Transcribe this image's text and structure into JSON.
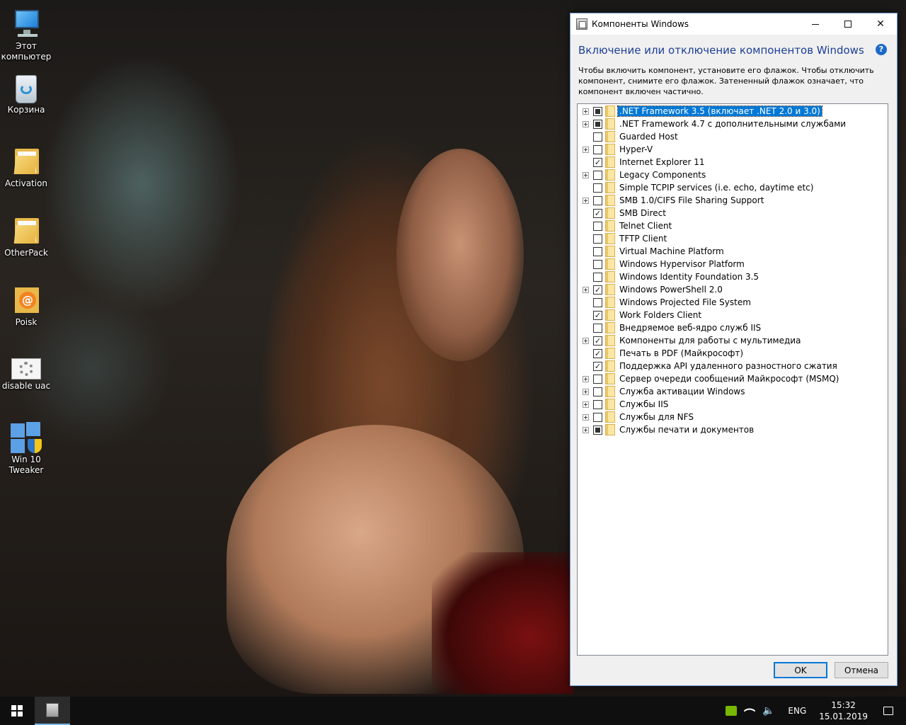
{
  "desktop": {
    "icons": [
      {
        "label": "Этот компьютер",
        "icon": "computer-icon"
      },
      {
        "label": "Корзина",
        "icon": "recycle-bin-icon"
      },
      {
        "label": "Activation",
        "icon": "folder-icon"
      },
      {
        "label": "OtherPack",
        "icon": "folder-icon"
      },
      {
        "label": "Poisk",
        "icon": "poisk-folder-icon"
      },
      {
        "label": "disable uac",
        "icon": "settings-shortcut-icon"
      },
      {
        "label": "Win 10 Tweaker",
        "icon": "tweaker-icon"
      }
    ]
  },
  "window": {
    "title": "Компоненты Windows",
    "heading": "Включение или отключение компонентов Windows",
    "help": "?",
    "description": "Чтобы включить компонент, установите его флажок. Чтобы отключить компонент, снимите его флажок. Затененный флажок означает, что компонент включен частично.",
    "features": [
      {
        "label": ".NET Framework 3.5 (включает .NET 2.0 и 3.0)",
        "expandable": true,
        "state": "partial",
        "selected": true
      },
      {
        "label": ".NET Framework 4.7 с дополнительными службами",
        "expandable": true,
        "state": "partial"
      },
      {
        "label": "Guarded Host",
        "expandable": false,
        "state": "unchecked"
      },
      {
        "label": "Hyper-V",
        "expandable": true,
        "state": "unchecked"
      },
      {
        "label": "Internet Explorer 11",
        "expandable": false,
        "state": "checked"
      },
      {
        "label": "Legacy Components",
        "expandable": true,
        "state": "unchecked"
      },
      {
        "label": "Simple TCPIP services (i.e. echo, daytime etc)",
        "expandable": false,
        "state": "unchecked"
      },
      {
        "label": "SMB 1.0/CIFS File Sharing Support",
        "expandable": true,
        "state": "unchecked"
      },
      {
        "label": "SMB Direct",
        "expandable": false,
        "state": "checked"
      },
      {
        "label": "Telnet Client",
        "expandable": false,
        "state": "unchecked"
      },
      {
        "label": "TFTP Client",
        "expandable": false,
        "state": "unchecked"
      },
      {
        "label": "Virtual Machine Platform",
        "expandable": false,
        "state": "unchecked"
      },
      {
        "label": "Windows Hypervisor Platform",
        "expandable": false,
        "state": "unchecked"
      },
      {
        "label": "Windows Identity Foundation 3.5",
        "expandable": false,
        "state": "unchecked"
      },
      {
        "label": "Windows PowerShell 2.0",
        "expandable": true,
        "state": "checked"
      },
      {
        "label": "Windows Projected File System",
        "expandable": false,
        "state": "unchecked"
      },
      {
        "label": "Work Folders Client",
        "expandable": false,
        "state": "checked"
      },
      {
        "label": "Внедряемое веб-ядро служб IIS",
        "expandable": false,
        "state": "unchecked"
      },
      {
        "label": "Компоненты для работы с мультимедиа",
        "expandable": true,
        "state": "checked"
      },
      {
        "label": "Печать в PDF (Майкрософт)",
        "expandable": false,
        "state": "checked"
      },
      {
        "label": "Поддержка API удаленного разностного сжатия",
        "expandable": false,
        "state": "checked"
      },
      {
        "label": "Сервер очереди сообщений Майкрософт (MSMQ)",
        "expandable": true,
        "state": "unchecked"
      },
      {
        "label": "Служба активации Windows",
        "expandable": true,
        "state": "unchecked"
      },
      {
        "label": "Службы IIS",
        "expandable": true,
        "state": "unchecked"
      },
      {
        "label": "Службы для NFS",
        "expandable": true,
        "state": "unchecked"
      },
      {
        "label": "Службы печати и документов",
        "expandable": true,
        "state": "partial"
      }
    ],
    "ok_label": "OK",
    "cancel_label": "Отмена"
  },
  "taskbar": {
    "language": "ENG",
    "time": "15:32",
    "date": "15.01.2019"
  }
}
